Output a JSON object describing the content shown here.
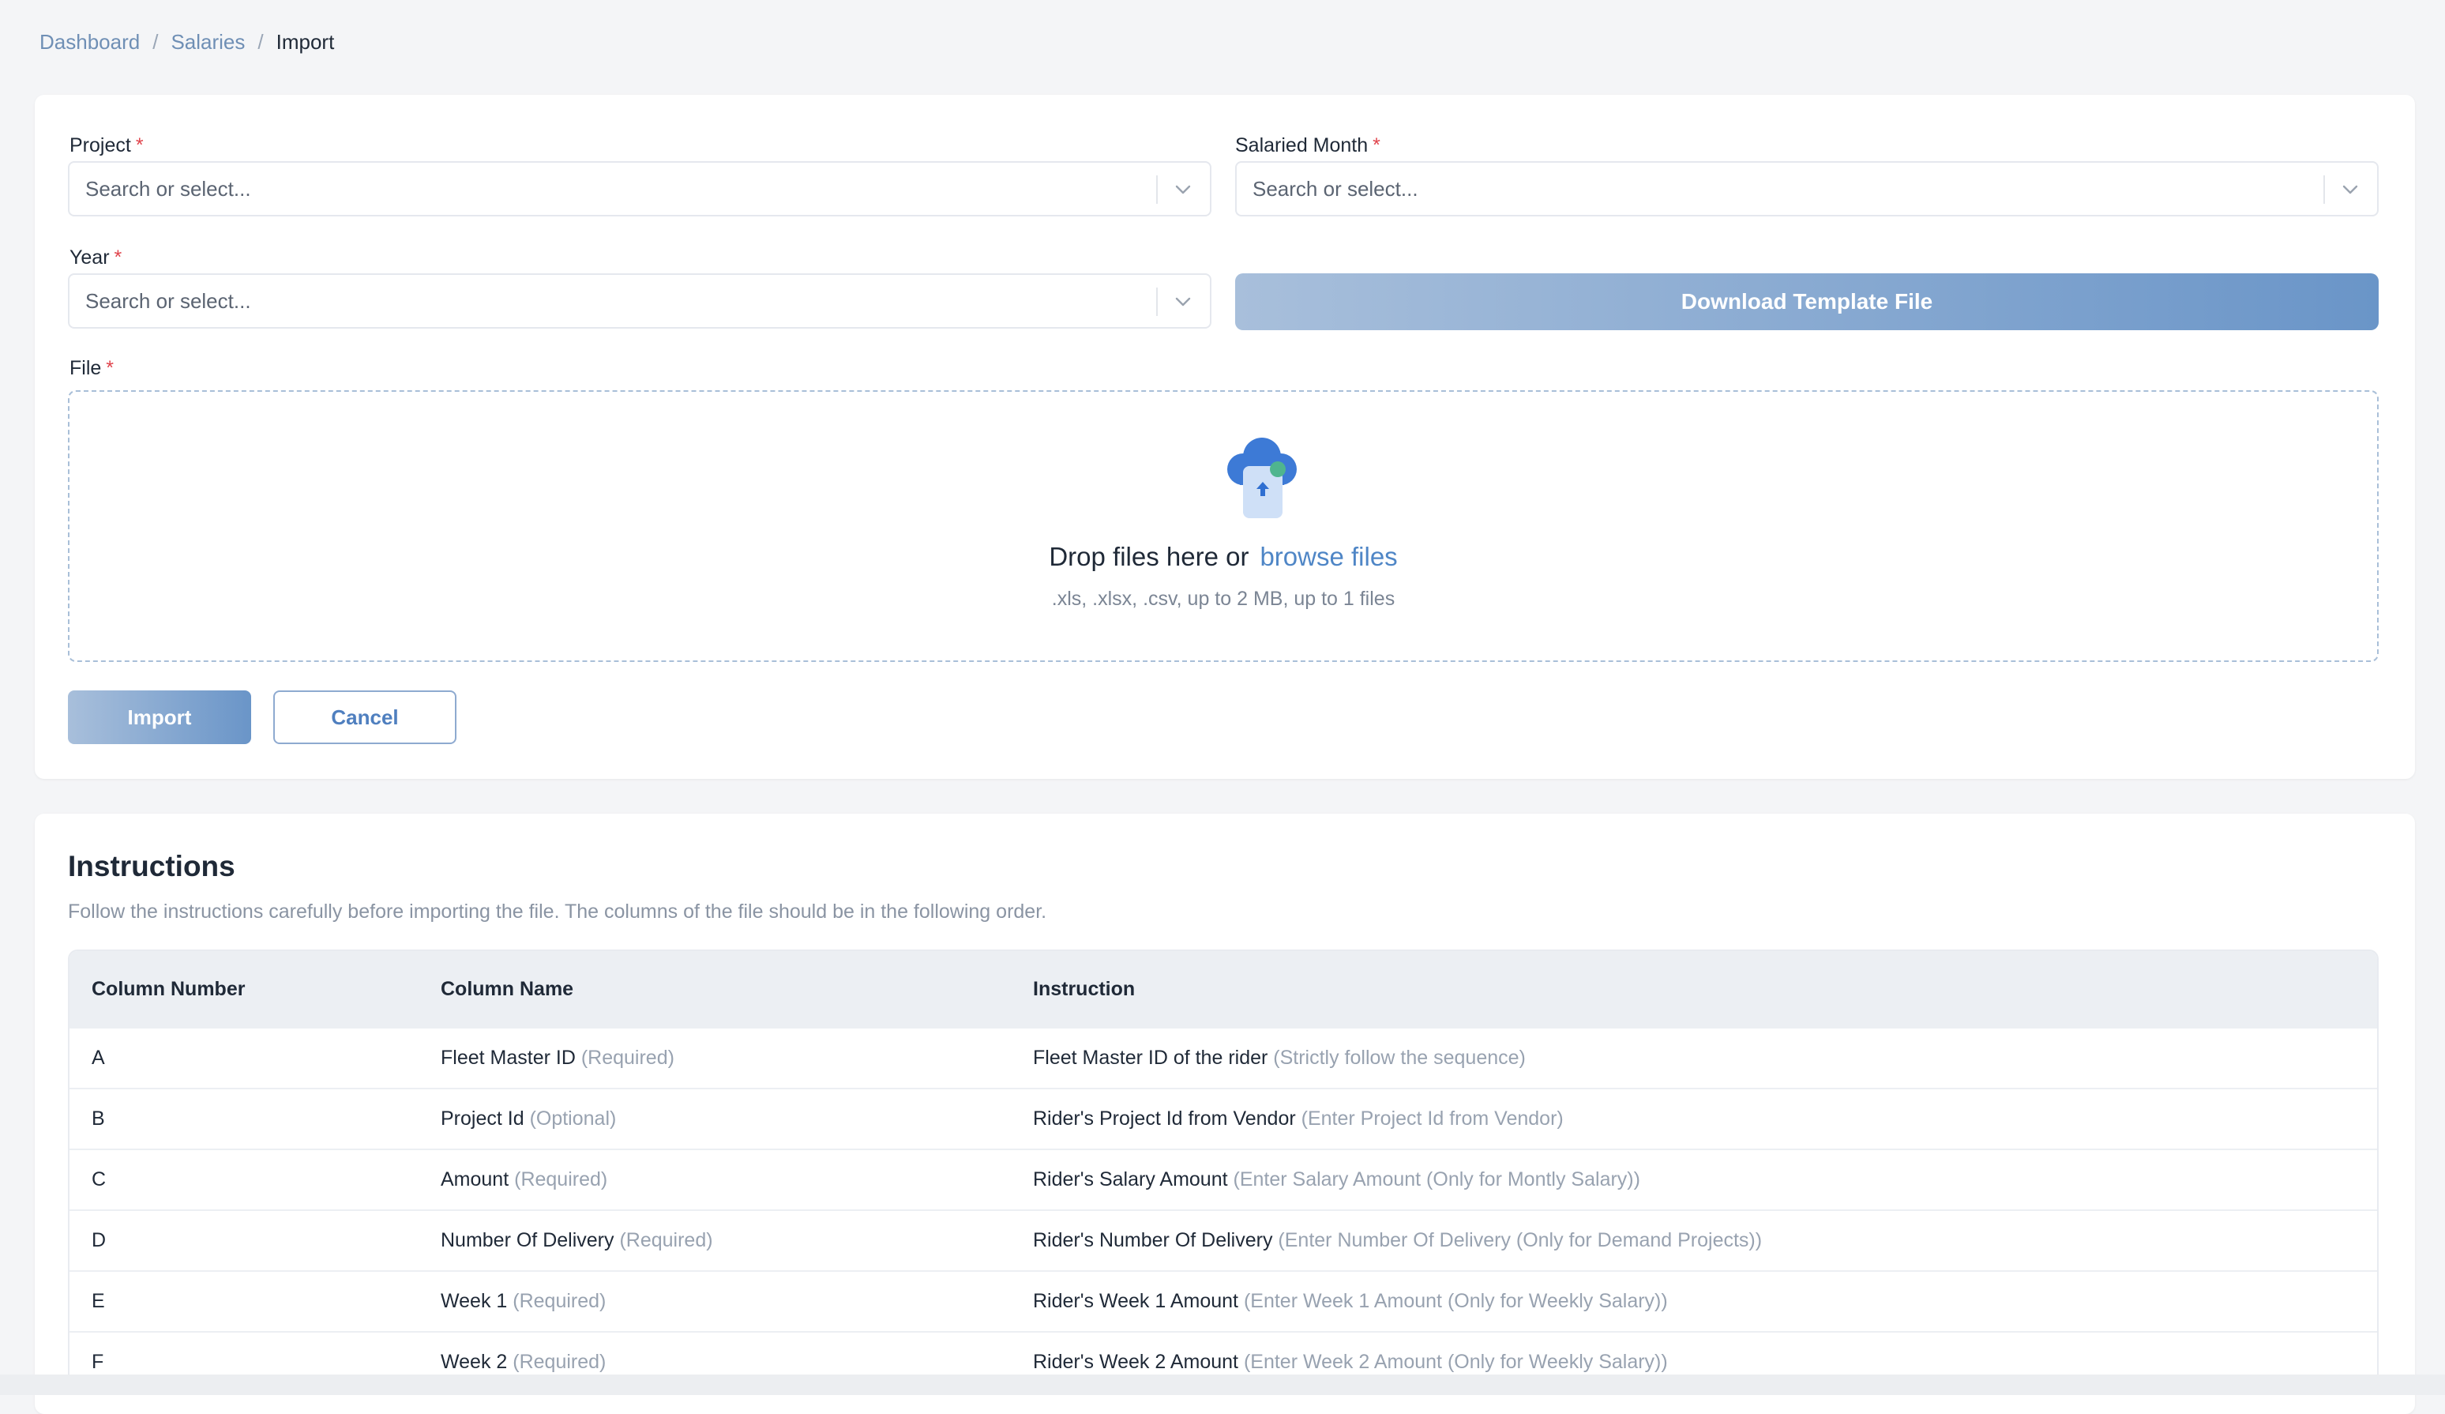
{
  "breadcrumb": {
    "items": [
      "Dashboard",
      "Salaries"
    ],
    "separator": "/",
    "current": "Import"
  },
  "form": {
    "project": {
      "label": "Project",
      "required_mark": "*",
      "placeholder": "Search or select..."
    },
    "salaried_month": {
      "label": "Salaried Month",
      "required_mark": "*",
      "placeholder": "Search or select..."
    },
    "year": {
      "label": "Year",
      "required_mark": "*",
      "placeholder": "Search or select..."
    },
    "download_template_label": "Download Template File",
    "file": {
      "label": "File",
      "required_mark": "*",
      "drop_text": "Drop files here or",
      "browse_text": "browse files",
      "hint": ".xls, .xlsx, .csv, up to 2 MB, up to 1 files"
    },
    "import_label": "Import",
    "cancel_label": "Cancel"
  },
  "instructions": {
    "title": "Instructions",
    "description": "Follow the instructions carefully before importing the file. The columns of the file should be in the following order.",
    "headers": [
      "Column Number",
      "Column Name",
      "Instruction"
    ],
    "rows": [
      {
        "col": "A",
        "name": "Fleet Master ID",
        "name_note": "(Required)",
        "instr": "Fleet Master ID of the rider",
        "instr_note": "(Strictly follow the sequence)"
      },
      {
        "col": "B",
        "name": "Project Id",
        "name_note": "(Optional)",
        "instr": "Rider's Project Id from Vendor",
        "instr_note": "(Enter Project Id from Vendor)"
      },
      {
        "col": "C",
        "name": "Amount",
        "name_note": "(Required)",
        "instr": "Rider's Salary Amount",
        "instr_note": "(Enter Salary Amount (Only for Montly Salary))"
      },
      {
        "col": "D",
        "name": "Number Of Delivery",
        "name_note": "(Required)",
        "instr": "Rider's Number Of Delivery",
        "instr_note": "(Enter Number Of Delivery (Only for Demand Projects))"
      },
      {
        "col": "E",
        "name": "Week 1",
        "name_note": "(Required)",
        "instr": "Rider's Week 1 Amount",
        "instr_note": "(Enter Week 1 Amount (Only for Weekly Salary))"
      },
      {
        "col": "F",
        "name": "Week 2",
        "name_note": "(Required)",
        "instr": "Rider's Week 2 Amount",
        "instr_note": "(Enter Week 2 Amount (Only for Weekly Salary))"
      }
    ]
  },
  "icons": {
    "chevron": "chevron-down-icon",
    "upload": "cloud-upload-icon"
  },
  "colors": {
    "accent": "#4f86c6",
    "required": "#e0444c",
    "button_gradient_start": "#a8bfdb",
    "button_gradient_end": "#6a95c8"
  }
}
